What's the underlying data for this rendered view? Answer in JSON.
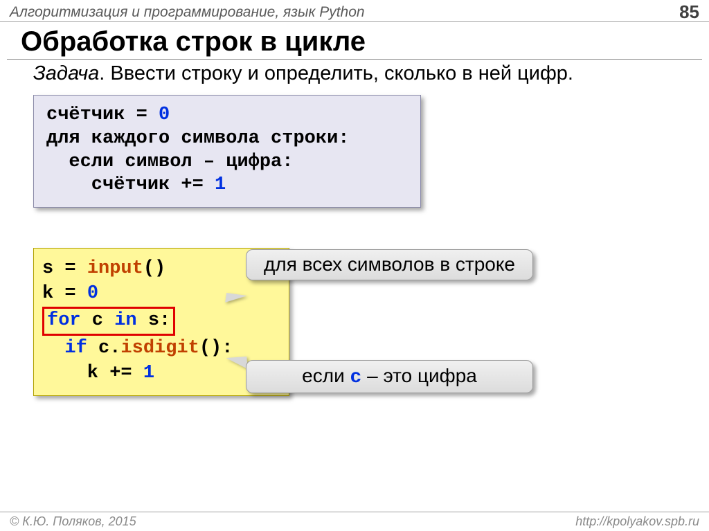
{
  "header": {
    "title": "Алгоритмизация и программирование, язык Python",
    "page": "85"
  },
  "h1": "Обработка строк в цикле",
  "task": {
    "label": "Задача",
    "text": ". Ввести строку и определить, сколько в ней цифр."
  },
  "pseudo": {
    "l1a": "счётчик = ",
    "l1b": "0",
    "l2": "для каждого символа строки:",
    "l3": "  если символ – цифра:",
    "l4a": "    счётчик += ",
    "l4b": "1"
  },
  "code": {
    "l1": {
      "a": "s = ",
      "fn": "input",
      "b": "()"
    },
    "l2": {
      "a": "k = ",
      "n": "0"
    },
    "l3": {
      "k1": "for",
      "a": " c ",
      "k2": "in",
      "b": " s:"
    },
    "l4": {
      "pad": "  ",
      "k": "if",
      "a": " c.",
      "fn": "isdigit",
      "b": "():"
    },
    "l5": {
      "pad": "    k += ",
      "n": "1"
    }
  },
  "callout1": "для всех символов в строке",
  "callout2": {
    "a": "если ",
    "v": "c",
    "b": " – это цифра"
  },
  "footer": {
    "left": "© К.Ю. Поляков, 2015",
    "right": "http://kpolyakov.spb.ru"
  }
}
